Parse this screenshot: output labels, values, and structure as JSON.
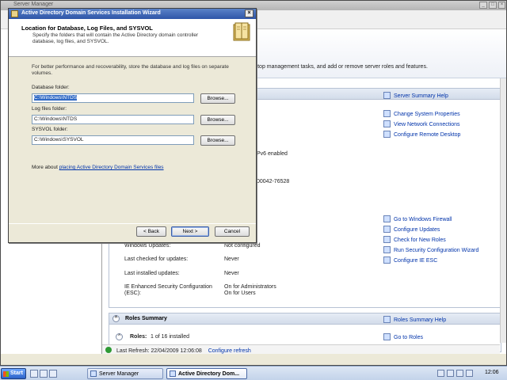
{
  "server_manager": {
    "title": "Server Manager",
    "banner_text": "rm top management tasks, and add or remove server roles and features.",
    "summary_help": "Server Summary Help",
    "computer_links": [
      "Change System Properties",
      "View Network Connections",
      "Configure Remote Desktop"
    ],
    "ipv6_fragment": "Pv6 enabled",
    "product_id_fragment": "00042-76528",
    "security_links": [
      "Go to Windows Firewall",
      "Configure Updates",
      "Check for New Roles",
      "Run Security Configuration Wizard",
      "Configure IE ESC"
    ],
    "security_rows": [
      {
        "label": "Windows Updates:",
        "value": "Not configured"
      },
      {
        "label": "Last checked for updates:",
        "value": "Never"
      },
      {
        "label": "Last installed updates:",
        "value": "Never"
      }
    ],
    "ie_esc_label": "IE Enhanced Security Configuration (ESC):",
    "ie_esc_values": [
      "On for Administrators",
      "On for Users"
    ],
    "roles_summary": "Roles Summary",
    "roles_summary_help": "Roles Summary Help",
    "roles_label": "Roles:",
    "roles_count": "1 of 16 installed",
    "go_to_roles": "Go to Roles",
    "last_refresh": "Last Refresh: 22/04/2009 12:06:08",
    "configure_refresh": "Configure refresh"
  },
  "dialog": {
    "title": "Active Directory Domain Services Installation Wizard",
    "heading": "Location for Database, Log Files, and SYSVOL",
    "subtext": "Specify the folders that will contain the Active Directory domain controller database, log files, and SYSVOL.",
    "intro": "For better performance and recoverability, store the database and log files on separate volumes.",
    "fields": [
      {
        "label": "Database folder:",
        "value": "C:\\Windows\\NTDS"
      },
      {
        "label": "Log files folder:",
        "value": "C:\\Windows\\NTDS"
      },
      {
        "label": "SYSVOL folder:",
        "value": "C:\\Windows\\SYSVOL"
      }
    ],
    "browse_label": "Browse...",
    "more_about_prefix": "More about",
    "more_about_link": "placing Active Directory Domain Services files",
    "back_label": "< Back",
    "next_label": "Next >",
    "cancel_label": "Cancel",
    "close_glyph": "×"
  },
  "taskbar": {
    "start_label": "Start",
    "tasks": [
      "Server Manager",
      "Active Directory Dom..."
    ],
    "clock": "12:06"
  },
  "colors": {
    "title_blue": "#2e55a8",
    "link_blue": "#0033aa",
    "selection": "#316ac5"
  }
}
